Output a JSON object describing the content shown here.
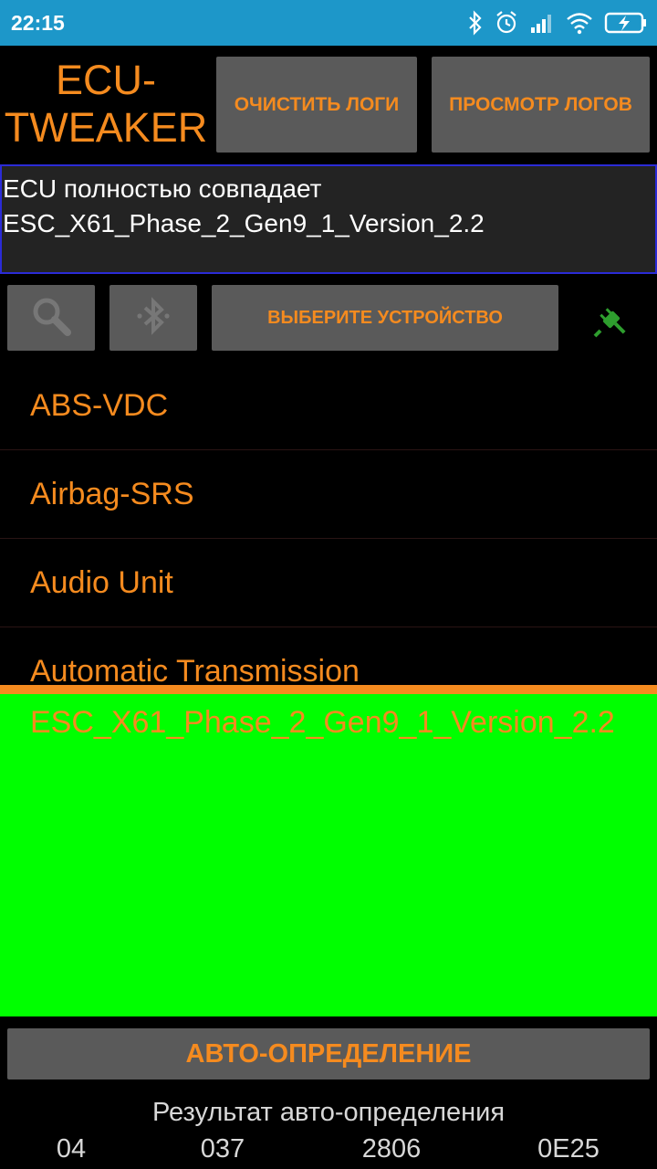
{
  "status_bar": {
    "time": "22:15",
    "icons": [
      "bluetooth-icon",
      "alarm-icon",
      "signal-icon",
      "wifi-icon",
      "battery-charging-icon"
    ]
  },
  "header": {
    "brand_line1": "ECU-",
    "brand_line2": "TWEAKER",
    "clear_logs": "ОЧИСТИТЬ ЛОГИ",
    "view_logs": "ПРОСМОТР ЛОГОВ"
  },
  "log": {
    "line1": "ECU полностью совпадает",
    "line2": "ESC_X61_Phase_2_Gen9_1_Version_2.2"
  },
  "toolbar": {
    "select_device": "ВЫБЕРИТЕ УСТРОЙСТВО",
    "icons": [
      "search-icon",
      "bluetooth-icon",
      "plug-icon"
    ]
  },
  "list": {
    "items": [
      {
        "label": "ABS-VDC"
      },
      {
        "label": "Airbag-SRS"
      },
      {
        "label": "Audio Unit"
      },
      {
        "label": "Automatic Transmission"
      }
    ]
  },
  "selected": {
    "label": "ESC_X61_Phase_2_Gen9_1_Version_2.2"
  },
  "auto": {
    "button": "АВТО-ОПРЕДЕЛЕНИЕ",
    "result_label": "Результат авто-определения",
    "codes": [
      "04",
      "037",
      "2806",
      "0E25"
    ]
  },
  "colors": {
    "accent": "#f58b1f",
    "status_bar": "#1d97c9",
    "highlight": "#00ff00",
    "button": "#5a5a5a"
  }
}
